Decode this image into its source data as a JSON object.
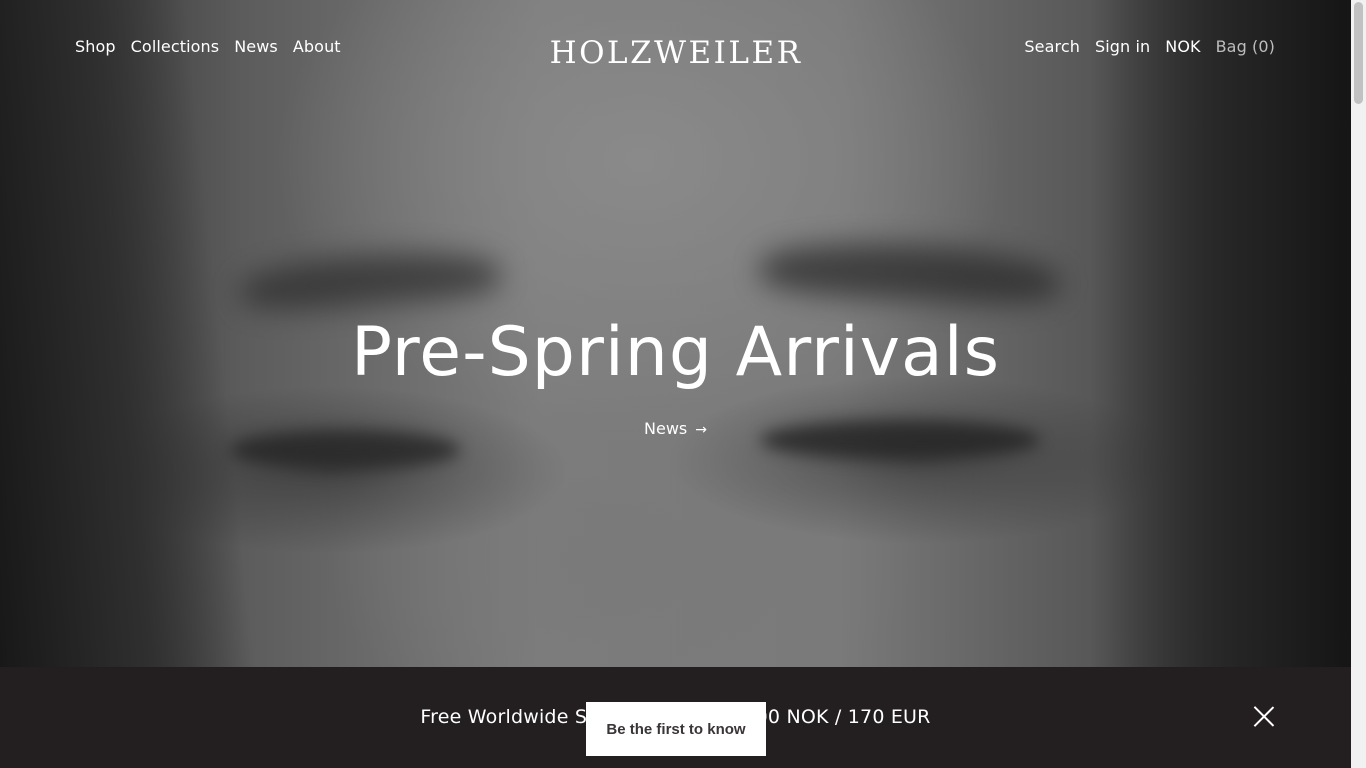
{
  "header": {
    "nav_left": [
      "Shop",
      "Collections",
      "News",
      "About"
    ],
    "logo": "HOLZWEILER",
    "nav_right": {
      "search": "Search",
      "sign_in": "Sign in",
      "currency": "NOK",
      "bag": "Bag (0)"
    }
  },
  "hero": {
    "title": "Pre-Spring Arrivals",
    "link_label": "News",
    "link_arrow": "→"
  },
  "banner": {
    "text": "Free Worldwide Shipping above 1500 NOK / 170 EUR",
    "close_icon": "close-icon"
  },
  "popup": {
    "button_label": "Be the first to know"
  },
  "colors": {
    "banner_bg": "#231f20",
    "popup_text": "#3a3536",
    "muted_link": "#bdbdbd"
  }
}
